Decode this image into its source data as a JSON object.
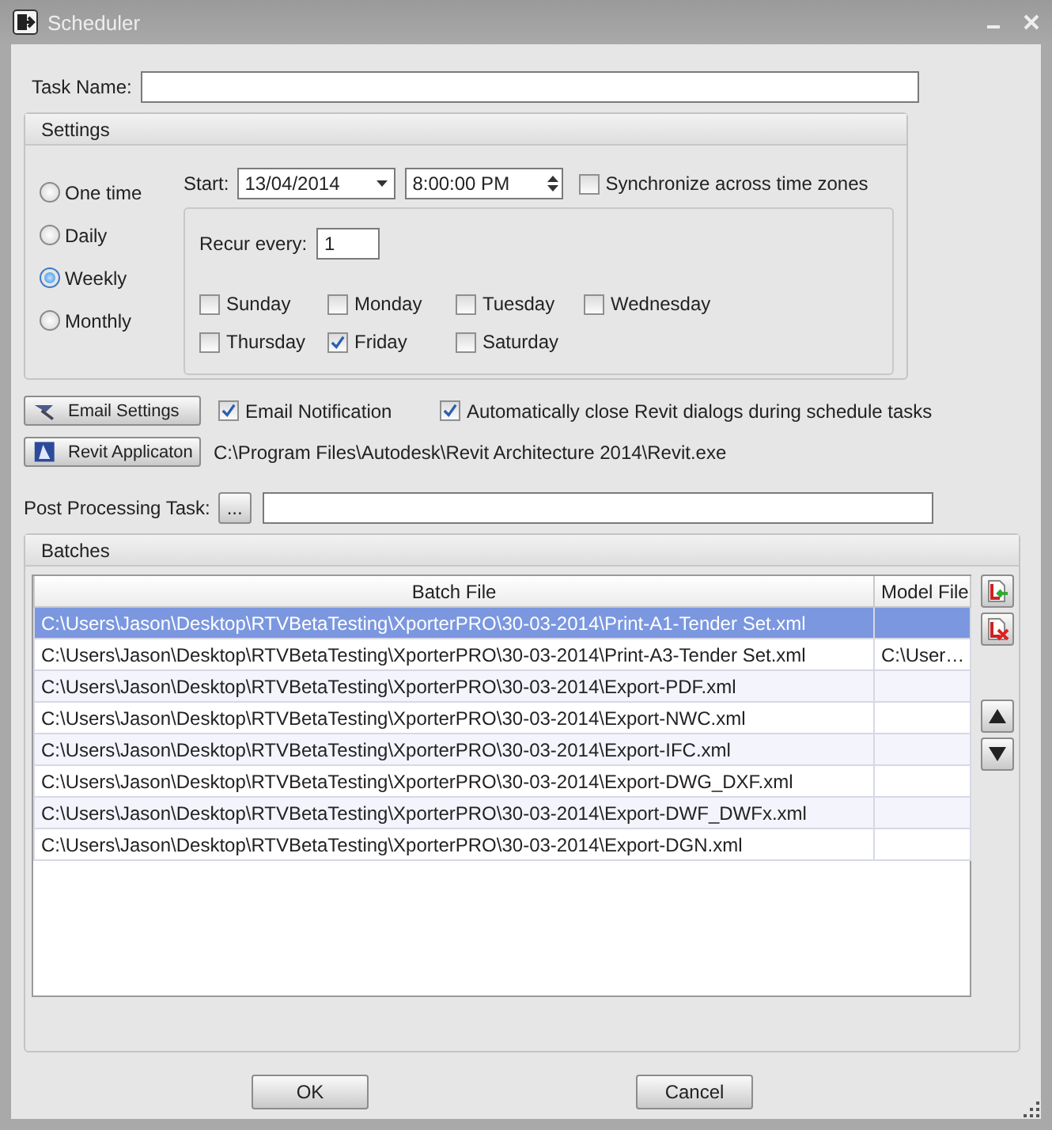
{
  "window": {
    "title": "Scheduler"
  },
  "task_name": {
    "label": "Task Name:"
  },
  "settings": {
    "title": "Settings",
    "frequency": [
      {
        "label": "One time",
        "selected": false
      },
      {
        "label": "Daily",
        "selected": false
      },
      {
        "label": "Weekly",
        "selected": true
      },
      {
        "label": "Monthly",
        "selected": false
      }
    ],
    "start": {
      "label": "Start:",
      "date": "13/04/2014",
      "time": "8:00:00 PM"
    },
    "synchronize": {
      "label": "Synchronize across time zones",
      "checked": false
    },
    "recur": {
      "label": "Recur every:",
      "value": "1"
    },
    "days": [
      {
        "label": "Sunday",
        "checked": false
      },
      {
        "label": "Monday",
        "checked": false
      },
      {
        "label": "Tuesday",
        "checked": false
      },
      {
        "label": "Wednesday",
        "checked": false
      },
      {
        "label": "Thursday",
        "checked": false
      },
      {
        "label": "Friday",
        "checked": true
      },
      {
        "label": "Saturday",
        "checked": false
      }
    ]
  },
  "email_settings_button": "Email Settings",
  "email_notification": {
    "label": "Email Notification",
    "checked": true
  },
  "auto_close": {
    "label": "Automatically close Revit dialogs during schedule tasks",
    "checked": true
  },
  "revit_button": "Revit Applicaton",
  "revit_path": "C:\\Program Files\\Autodesk\\Revit Architecture 2014\\Revit.exe",
  "post_processing": {
    "label": "Post Processing Task:",
    "browse": "..."
  },
  "batches": {
    "title": "Batches",
    "columns": [
      "Batch File",
      "Model File"
    ],
    "rows": [
      {
        "batch_file": "C:\\Users\\Jason\\Desktop\\RTVBetaTesting\\XporterPRO\\30-03-2014\\Print-A1-Tender Set.xml",
        "selected": true
      },
      {
        "batch_file": "C:\\Users\\Jason\\Desktop\\RTVBetaTesting\\XporterPRO\\30-03-2014\\Print-A3-Tender Set.xml",
        "model_file": "C:\\User…",
        "selected": false
      },
      {
        "batch_file": "C:\\Users\\Jason\\Desktop\\RTVBetaTesting\\XporterPRO\\30-03-2014\\Export-PDF.xml",
        "selected": false
      },
      {
        "batch_file": "C:\\Users\\Jason\\Desktop\\RTVBetaTesting\\XporterPRO\\30-03-2014\\Export-NWC.xml",
        "selected": false
      },
      {
        "batch_file": "C:\\Users\\Jason\\Desktop\\RTVBetaTesting\\XporterPRO\\30-03-2014\\Export-IFC.xml",
        "selected": false
      },
      {
        "batch_file": "C:\\Users\\Jason\\Desktop\\RTVBetaTesting\\XporterPRO\\30-03-2014\\Export-DWG_DXF.xml",
        "selected": false
      },
      {
        "batch_file": "C:\\Users\\Jason\\Desktop\\RTVBetaTesting\\XporterPRO\\30-03-2014\\Export-DWF_DWFx.xml",
        "selected": false
      },
      {
        "batch_file": "C:\\Users\\Jason\\Desktop\\RTVBetaTesting\\XporterPRO\\30-03-2014\\Export-DGN.xml",
        "selected": false
      }
    ]
  },
  "buttons": [
    "OK",
    "Cancel"
  ]
}
